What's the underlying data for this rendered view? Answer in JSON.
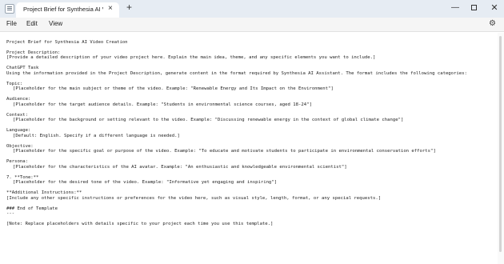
{
  "window": {
    "tab_title": "Project Brief for Synthesia AI Vide",
    "tab_close": "×",
    "new_tab": "+",
    "minimize": "—",
    "close": "✕"
  },
  "menu": {
    "file": "File",
    "edit": "Edit",
    "view": "View"
  },
  "settings_icon": "gear-icon",
  "document": {
    "title": "Project Brief for Synthesia AI Video Creation",
    "desc_heading": "Project Description:",
    "desc_body": "[Provide a detailed description of your video project here. Explain the main idea, theme, and any specific elements you want to include.]",
    "task_heading": "ChatGPT Task",
    "task_body": "Using the information provided in the Project Description, generate content in the format required by Synthesia AI Assistant. The format includes the following categories:",
    "topic_heading": "Topic:",
    "topic_body": "[Placeholder for the main subject or theme of the video. Example: \"Renewable Energy and Its Impact on the Environment\"]",
    "audience_heading": "Audience:",
    "audience_body": "[Placeholder for the target audience details. Example: \"Students in environmental science courses, aged 18-24\"]",
    "context_heading": "Context:",
    "context_body": "[Placeholder for the background or setting relevant to the video. Example: \"Discussing renewable energy in the context of global climate change\"]",
    "language_heading": "Language:",
    "language_body": "[Default: English. Specify if a different language is needed.]",
    "objective_heading": "Objective:",
    "objective_body": "[Placeholder for the specific goal or purpose of the video. Example: \"To educate and motivate students to participate in environmental conservation efforts\"]",
    "persona_heading": "Persona:",
    "persona_body": "[Placeholder for the characteristics of the AI avatar. Example: \"An enthusiastic and knowledgeable environmental scientist\"]",
    "tone_heading": "7. **Tone:**",
    "tone_body": "[Placeholder for the desired tone of the video. Example: \"Informative yet engaging and inspiring\"]",
    "additional_heading": "**Additional Instructions:**",
    "additional_body": "[Include any other specific instructions or preferences for the video here, such as visual style, length, format, or any special requests.]",
    "end_heading": "### End of Template",
    "end_marker": "---",
    "note": "[Note: Replace placeholders with details specific to your project each time you use this template.]"
  }
}
